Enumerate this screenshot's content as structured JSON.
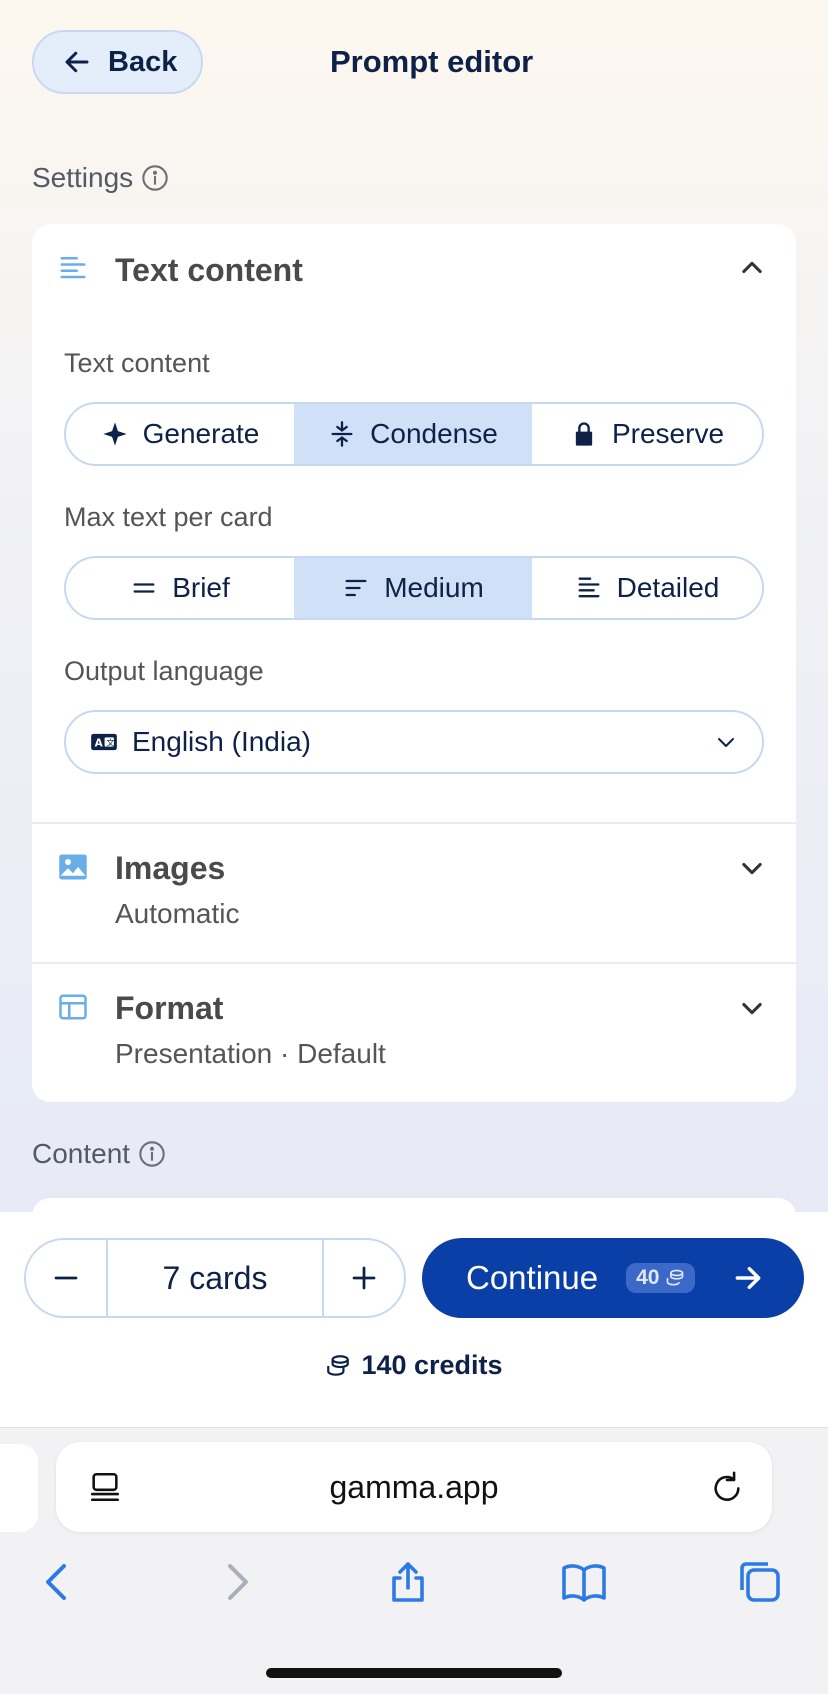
{
  "header": {
    "back_label": "Back",
    "title": "Prompt editor"
  },
  "settings": {
    "label": "Settings",
    "text_content": {
      "title": "Text content",
      "field_label": "Text content",
      "options": [
        "Generate",
        "Condense",
        "Preserve"
      ],
      "selected": "Condense",
      "max_label": "Max text per card",
      "max_options": [
        "Brief",
        "Medium",
        "Detailed"
      ],
      "max_selected": "Medium",
      "lang_label": "Output language",
      "lang_value": "English (India)"
    },
    "images": {
      "title": "Images",
      "value": "Automatic"
    },
    "format": {
      "title": "Format",
      "value": "Presentation · Default"
    }
  },
  "content": {
    "label": "Content"
  },
  "footer": {
    "card_count": "7 cards",
    "continue_label": "Continue",
    "continue_cost": "40",
    "credits": "140 credits"
  },
  "browser": {
    "url": "gamma.app"
  },
  "colors": {
    "accent": "#0a3fa8",
    "selected_bg": "#cfe0f7",
    "border": "#c7d8f0"
  }
}
